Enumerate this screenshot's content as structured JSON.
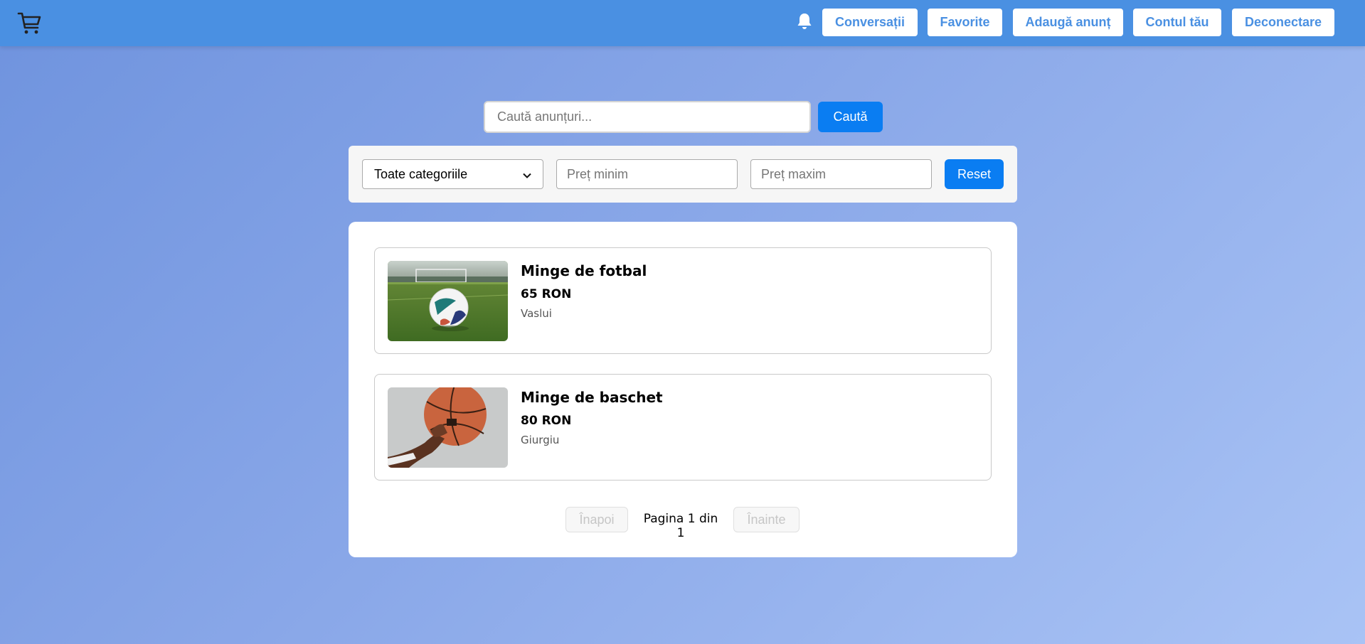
{
  "header": {
    "logo_icon": "shopping-cart-icon",
    "notification_icon": "bell-icon",
    "nav": {
      "conversations": "Conversații",
      "favorites": "Favorite",
      "add_listing": "Adaugă anunț",
      "account": "Contul tău",
      "logout": "Deconectare"
    }
  },
  "search": {
    "placeholder": "Caută anunțuri...",
    "value": "",
    "button_label": "Caută"
  },
  "filters": {
    "category_selected": "Toate categoriile",
    "min_price_placeholder": "Preț minim",
    "max_price_placeholder": "Preț maxim",
    "reset_label": "Reset"
  },
  "listings": [
    {
      "title": "Minge de fotbal",
      "price": "65 RON",
      "location": "Vaslui",
      "image": "football-photo"
    },
    {
      "title": "Minge de baschet",
      "price": "80 RON",
      "location": "Giurgiu",
      "image": "basketball-photo"
    }
  ],
  "pagination": {
    "prev_label": "Înapoi",
    "info": "Pagina 1 din 1",
    "next_label": "Înainte"
  },
  "colors": {
    "header_bg": "#4a90e2",
    "primary_button": "#0a7df2",
    "nav_text": "#4a90e2"
  }
}
